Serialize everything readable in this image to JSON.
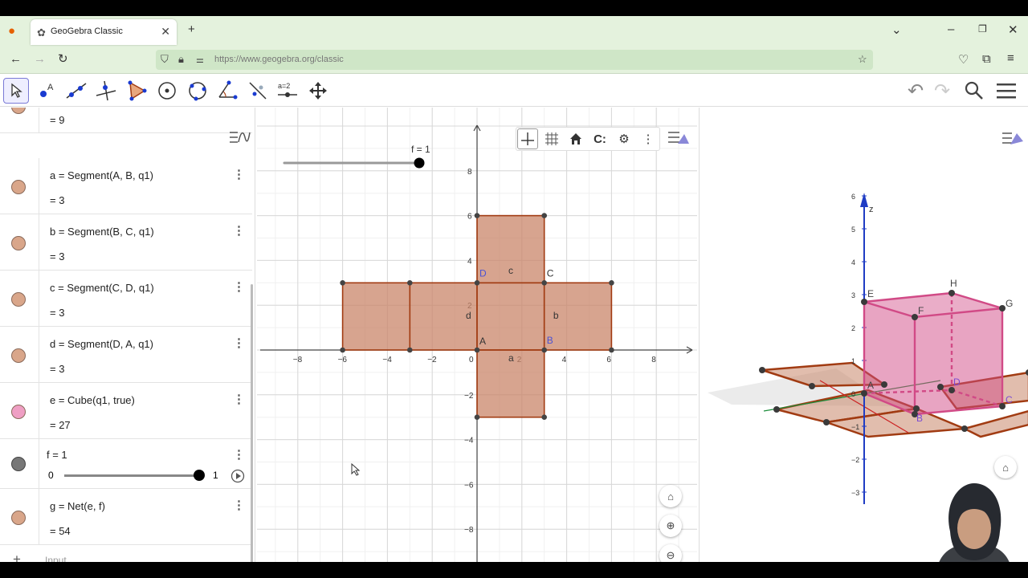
{
  "browser": {
    "tab_title": "GeoGebra Classic",
    "url": "https://www.geogebra.org/classic",
    "new_tab": "+",
    "icons": [
      "firefox-icon",
      "back-icon",
      "forward-icon",
      "reload-icon",
      "shield-icon",
      "lock-icon",
      "bookmark-star-icon",
      "pocket-icon",
      "extensions-icon",
      "menu-icon"
    ]
  },
  "toolbar": {
    "a2_label": "a=2",
    "tools": [
      "move-tool",
      "point-tool",
      "line-tool",
      "perpendicular-tool",
      "polygon-tool",
      "circle-center-tool",
      "circle-3points-tool",
      "angle-tool",
      "reflect-tool",
      "slider-tool",
      "move-graphics-tool"
    ]
  },
  "algebra": {
    "top_value": "= 9",
    "rows": [
      {
        "def": "a  =  Segment(A, B, q1)",
        "val": "=  3",
        "color": "#d9a68a"
      },
      {
        "def": "b  =  Segment(B, C, q1)",
        "val": "=  3",
        "color": "#d9a68a"
      },
      {
        "def": "c  =  Segment(C, D, q1)",
        "val": "=  3",
        "color": "#d9a68a"
      },
      {
        "def": "d  =  Segment(D, A, q1)",
        "val": "=  3",
        "color": "#d9a68a"
      },
      {
        "def": "e  =  Cube(q1, true)",
        "val": "=  27",
        "color": "#ef9fc4"
      },
      {
        "def": "g  =  Net(e, f)",
        "val": "=  54",
        "color": "#d9a68a"
      }
    ],
    "slider": {
      "def": "f = 1",
      "min": "0",
      "max": "1",
      "value": 1
    },
    "input_placeholder": "Input..."
  },
  "graphics2d": {
    "slider_label": "f = 1",
    "x_ticks": [
      "−8",
      "−6",
      "−4",
      "−2",
      "0",
      "2",
      "4",
      "6",
      "8"
    ],
    "y_ticks": [
      "8",
      "6",
      "4",
      "2",
      "−2",
      "−4",
      "−6",
      "−8"
    ],
    "point_labels": [
      "A",
      "B",
      "C",
      "D"
    ],
    "segment_labels": [
      "a",
      "b",
      "c",
      "d"
    ],
    "origin": "0"
  },
  "graphics3d": {
    "z_axis": "z",
    "z_ticks": [
      "6",
      "5",
      "4",
      "3",
      "2",
      "1",
      "0",
      "−1",
      "−2",
      "−3"
    ],
    "vertex_labels": [
      "E",
      "F",
      "H",
      "G",
      "A",
      "B",
      "C",
      "D"
    ]
  },
  "colors": {
    "net_fill": "#c9866a",
    "net_stroke": "#a13b12",
    "cube": "#d14a86",
    "axis_blue": "#1f3cc4"
  }
}
